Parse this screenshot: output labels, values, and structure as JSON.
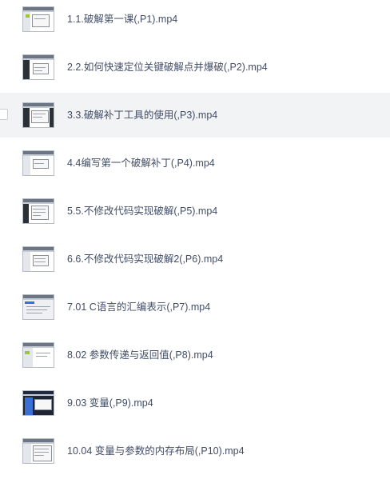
{
  "files": [
    {
      "name": "1.1.破解第一课(,P1).mp4",
      "icon": "video-thumbnail-icon"
    },
    {
      "name": "2.2.如何快速定位关键破解点并爆破(,P2).mp4",
      "icon": "video-thumbnail-icon"
    },
    {
      "name": "3.3.破解补丁工具的使用(,P3).mp4",
      "icon": "video-thumbnail-icon"
    },
    {
      "name": "4.4编写第一个破解补丁(,P4).mp4",
      "icon": "video-thumbnail-icon"
    },
    {
      "name": "5.5.不修改代码实现破解(,P5).mp4",
      "icon": "video-thumbnail-icon"
    },
    {
      "name": "6.6.不修改代码实现破解2(,P6).mp4",
      "icon": "video-thumbnail-icon"
    },
    {
      "name": "7.01 C语言的汇编表示(,P7).mp4",
      "icon": "video-thumbnail-icon"
    },
    {
      "name": "8.02 参数传递与返回值(,P8).mp4",
      "icon": "video-thumbnail-icon"
    },
    {
      "name": "9.03 变量(,P9).mp4",
      "icon": "video-thumbnail-icon"
    },
    {
      "name": "10.04 变量与参数的内存布局(,P10).mp4",
      "icon": "video-thumbnail-icon"
    }
  ],
  "colors": {
    "text": "#424e67",
    "hover_row": "#f2f3f5"
  }
}
